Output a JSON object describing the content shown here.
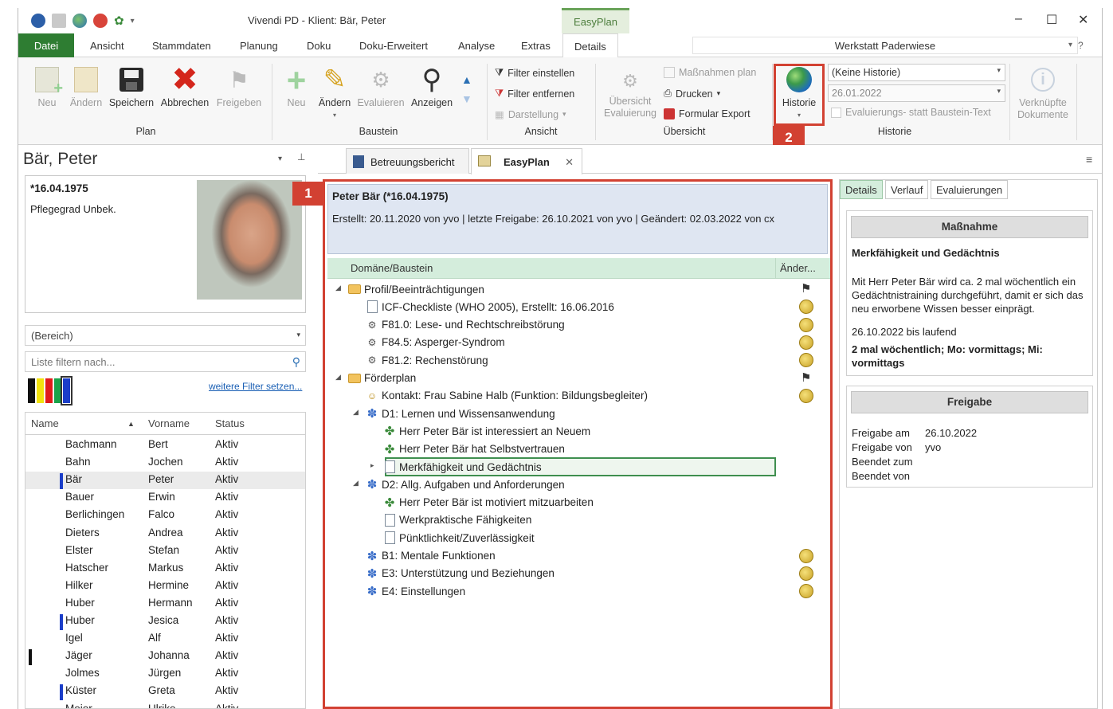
{
  "window": {
    "title": "Vivendi PD - Klient: Bär, Peter",
    "context_tab": "EasyPlan"
  },
  "menu": {
    "tabs": [
      "Datei",
      "Ansicht",
      "Stammdaten",
      "Planung",
      "Doku",
      "Doku-Erweitert",
      "Analyse",
      "Extras",
      "Details"
    ],
    "workshop": "Werkstatt Paderwiese",
    "help": "?"
  },
  "ribbon": {
    "plan": {
      "label": "Plan",
      "buttons": [
        "Neu",
        "Ändern",
        "Speichern",
        "Abbrechen",
        "Freigeben"
      ]
    },
    "baustein": {
      "label": "Baustein",
      "buttons": [
        "Neu",
        "Ändern",
        "Evaluieren",
        "Anzeigen"
      ]
    },
    "ansicht": {
      "label": "Ansicht",
      "filter_set": "Filter einstellen",
      "filter_remove": "Filter entfernen",
      "display": "Darstellung"
    },
    "uebersicht": {
      "label": "Übersicht",
      "overview_eval": "Übersicht Evaluierung",
      "massnahmen_plan": "Maßnahmen plan",
      "print": "Drucken",
      "form_export": "Formular Export"
    },
    "historie": {
      "label": "Historie",
      "button": "Historie",
      "combo_history": "(Keine Historie)",
      "combo_date": "26.01.2022",
      "checkbox": "Evaluierungs- statt Baustein-Text"
    },
    "documents": {
      "line1": "Verknüpfte",
      "line2": "Dokumente"
    }
  },
  "badges": {
    "one": "1",
    "two": "2"
  },
  "client": {
    "name": "Bär, Peter",
    "dob": "*16.04.1975",
    "care_level": "Pflegegrad Unbek.",
    "area_placeholder": "(Bereich)",
    "filter_placeholder": "Liste filtern nach...",
    "more_filters": "weitere Filter setzen..."
  },
  "client_list": {
    "headers": [
      "Name",
      "Vorname",
      "Status"
    ],
    "rows": [
      {
        "last": "Bachmann",
        "first": "Bert",
        "status": "Aktiv"
      },
      {
        "last": "Bahn",
        "first": "Jochen",
        "status": "Aktiv"
      },
      {
        "last": "Bär",
        "first": "Peter",
        "status": "Aktiv"
      },
      {
        "last": "Bauer",
        "first": "Erwin",
        "status": "Aktiv"
      },
      {
        "last": "Berlichingen",
        "first": "Falco",
        "status": "Aktiv"
      },
      {
        "last": "Dieters",
        "first": "Andrea",
        "status": "Aktiv"
      },
      {
        "last": "Elster",
        "first": "Stefan",
        "status": "Aktiv"
      },
      {
        "last": "Hatscher",
        "first": "Markus",
        "status": "Aktiv"
      },
      {
        "last": "Hilker",
        "first": "Hermine",
        "status": "Aktiv"
      },
      {
        "last": "Huber",
        "first": "Hermann",
        "status": "Aktiv"
      },
      {
        "last": "Huber",
        "first": "Jesica",
        "status": "Aktiv"
      },
      {
        "last": "Igel",
        "first": "Alf",
        "status": "Aktiv"
      },
      {
        "last": "Jäger",
        "first": "Johanna",
        "status": "Aktiv"
      },
      {
        "last": "Jolmes",
        "first": "Jürgen",
        "status": "Aktiv"
      },
      {
        "last": "Küster",
        "first": "Greta",
        "status": "Aktiv"
      },
      {
        "last": "Meier",
        "first": "Ulrike",
        "status": "Aktiv"
      }
    ]
  },
  "doc_tabs": [
    "Betreuungsbericht",
    "EasyPlan"
  ],
  "plan": {
    "person": "Peter Bär (*16.04.1975)",
    "meta": "Erstellt: 20.11.2020 von yvo | letzte Freigabe: 26.10.2021 von yvo | Geändert: 02.03.2022 von cx",
    "columns": [
      "Domäne/Baustein",
      "Änder..."
    ],
    "rows": [
      "Profil/Beeinträchtigungen",
      "ICF-Checkliste (WHO 2005), Erstellt: 16.06.2016",
      "F81.0: Lese- und Rechtschreibstörung",
      "F84.5: Asperger-Syndrom",
      "F81.2: Rechenstörung",
      "Förderplan",
      "Kontakt: Frau Sabine Halb (Funktion: Bildungsbegleiter)",
      "D1: Lernen und Wissensanwendung",
      "Herr Peter Bär ist interessiert an Neuem",
      "Herr Peter Bär hat Selbstvertrauen",
      "Merkfähigkeit und Gedächtnis",
      "D2: Allg. Aufgaben und Anforderungen",
      "Herr Peter Bär ist motiviert mitzuarbeiten",
      "Werkpraktische Fähigkeiten",
      "Pünktlichkeit/Zuverlässigkeit",
      "B1: Mentale Funktionen",
      "E3: Unterstützung und Beziehungen",
      "E4: Einstellungen"
    ]
  },
  "details": {
    "tabs": [
      "Details",
      "Verlauf",
      "Evaluierungen"
    ],
    "measure_header": "Maßnahme",
    "measure_title": "Merkfähigkeit und Gedächtnis",
    "measure_text": "Mit Herr Peter Bär wird ca. 2 mal wöchentlich ein Gedächtnistraining durchgeführt, damit er sich das neu erworbene Wissen besser einprägt.",
    "period": "26.10.2022 bis laufend",
    "frequency": "2 mal wöchentlich; Mo: vormittags; Mi: vormittags",
    "release_header": "Freigabe",
    "release_on_label": "Freigabe am",
    "release_on_value": "26.10.2022",
    "release_by_label": "Freigabe von",
    "release_by_value": "yvo",
    "ended_on_label": "Beendet zum",
    "ended_by_label": "Beendet von"
  },
  "colors": {
    "accent_green": "#2e7d32",
    "highlight_red": "#d24132",
    "tree_header": "#d4eddc",
    "info_blue": "#dfe6f2"
  }
}
